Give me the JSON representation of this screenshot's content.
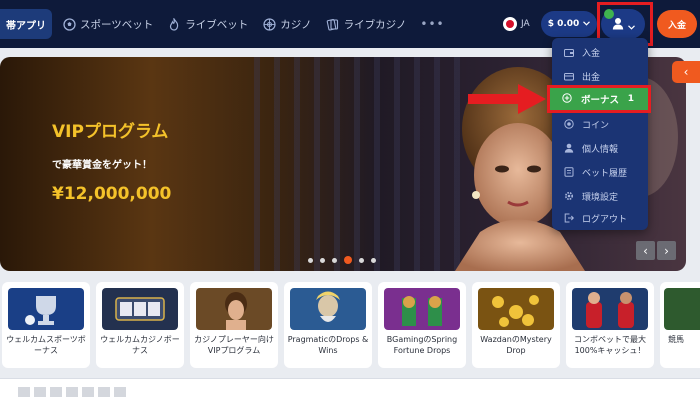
{
  "nav": {
    "app_label": "帯アプリ",
    "items": [
      {
        "label": "スポーツベット",
        "icon": "soccer-ball-icon"
      },
      {
        "label": "ライブベット",
        "icon": "fire-icon"
      },
      {
        "label": "カジノ",
        "icon": "roulette-icon"
      },
      {
        "label": "ライブカジノ",
        "icon": "cards-icon"
      }
    ],
    "more": "•••",
    "lang": "JA",
    "balance": "$ 0.00",
    "deposit": "入金"
  },
  "dropdown": {
    "items": [
      {
        "label": "入金",
        "icon": "wallet-icon"
      },
      {
        "label": "出金",
        "icon": "withdraw-icon"
      },
      {
        "label": "コイン",
        "icon": "coin-icon"
      },
      {
        "label": "個人情報",
        "icon": "person-icon"
      },
      {
        "label": "ベット履歴",
        "icon": "history-icon"
      },
      {
        "label": "環境設定",
        "icon": "settings-icon"
      },
      {
        "label": "ログアウト",
        "icon": "logout-icon"
      }
    ],
    "bonus": {
      "label": "ボーナス",
      "count": "1",
      "icon": "plus-circle-icon"
    }
  },
  "banner": {
    "title": "VIPプログラム",
    "subtitle": "で豪華賞金をゲット！",
    "amount": "¥12,000,000",
    "dots_total": 6,
    "dots_active": 3
  },
  "cards": [
    {
      "caption": "ウェルカムスポーツボーナス",
      "color": "#1a3f86"
    },
    {
      "caption": "ウェルカムカジノボーナス",
      "color": "#23314f"
    },
    {
      "caption": "カジノプレーヤー向け VIPプログラム",
      "color": "#6b4a26"
    },
    {
      "caption": "PragmaticのDrops & Wins",
      "color": "#2b5b93"
    },
    {
      "caption": "BGamingのSpring Fortune Drops",
      "color": "#7a2f8f"
    },
    {
      "caption": "WazdanのMystery Drop",
      "color": "#7a5312"
    },
    {
      "caption": "コンボベットで最大100%キャッシュ！",
      "color": "#1f3c6e"
    },
    {
      "caption": "競馬",
      "color": "#2e5a2e"
    }
  ]
}
